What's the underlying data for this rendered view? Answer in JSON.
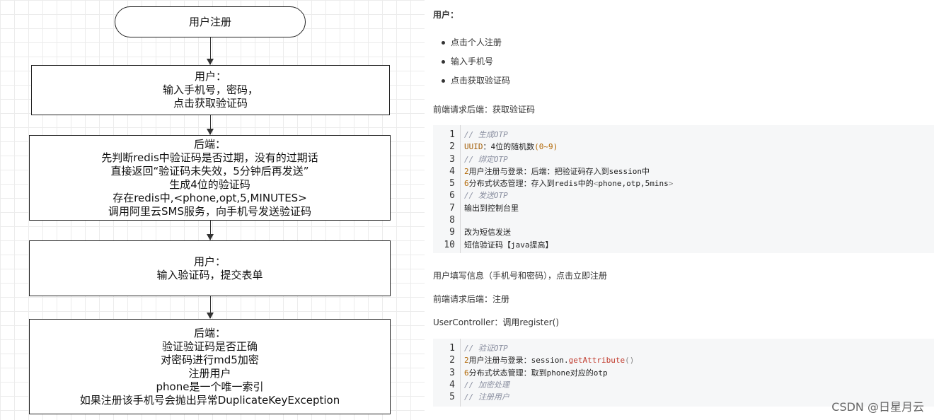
{
  "flowchart": {
    "start": "用户注册",
    "step1": [
      "用户：",
      "输入手机号，密码，",
      "点击获取验证码"
    ],
    "step2": [
      "后端：",
      "先判断redis中验证码是否过期，没有的过期话",
      "直接返回“验证码未失效，5分钟后再发送”",
      "生成4位的验证码",
      "存在redis中,<phone,opt,5,MINUTES>",
      "调用阿里云SMS服务，向手机号发送验证码"
    ],
    "step3": [
      "用户：",
      "输入验证码，提交表单"
    ],
    "step4": [
      "后端：",
      "验证验证码是否正确",
      "对密码进行md5加密",
      "注册用户",
      "phone是一个唯一索引",
      "如果注册该手机号会抛出异常DuplicateKeyException"
    ]
  },
  "doc": {
    "heading": "用户：",
    "bullets": [
      "点击个人注册",
      "输入手机号",
      "点击获取验证码"
    ],
    "p1": "前端请求后端：获取验证码",
    "code1": [
      {
        "n": "1",
        "segs": [
          {
            "t": "// 生成OTP",
            "c": "cm"
          }
        ]
      },
      {
        "n": "2",
        "segs": [
          {
            "t": "UUID",
            "c": "kw"
          },
          {
            "t": "：4位的随机数",
            "c": ""
          },
          {
            "t": "(0~9)",
            "c": "num"
          }
        ]
      },
      {
        "n": "3",
        "segs": [
          {
            "t": "// 绑定OTP",
            "c": "cm"
          }
        ]
      },
      {
        "n": "4",
        "segs": [
          {
            "t": "2",
            "c": "num"
          },
          {
            "t": "用户注册与登录：后端：把验证码存入到session中",
            "c": ""
          }
        ]
      },
      {
        "n": "5",
        "segs": [
          {
            "t": "6",
            "c": "num"
          },
          {
            "t": "分布式状态管理：存入到redis中的",
            "c": ""
          },
          {
            "t": "<",
            "c": "op"
          },
          {
            "t": "phone,otp,5mins",
            "c": ""
          },
          {
            "t": ">",
            "c": "op"
          }
        ]
      },
      {
        "n": "6",
        "segs": [
          {
            "t": "// 发送OTP",
            "c": "cm"
          }
        ]
      },
      {
        "n": "7",
        "segs": [
          {
            "t": "输出到控制台里",
            "c": ""
          }
        ]
      },
      {
        "n": "8",
        "segs": []
      },
      {
        "n": "9",
        "segs": [
          {
            "t": "改为短信发送",
            "c": ""
          }
        ]
      },
      {
        "n": "10",
        "segs": [
          {
            "t": "短信验证码【java提高】",
            "c": ""
          }
        ]
      }
    ],
    "p2": "用户填写信息（手机号和密码），点击立即注册",
    "p3": "前端请求后端：注册",
    "p4": "UserController：调用register()",
    "code2": [
      {
        "n": "1",
        "segs": [
          {
            "t": "// 验证OTP",
            "c": "cm"
          }
        ]
      },
      {
        "n": "2",
        "segs": [
          {
            "t": "2",
            "c": "num"
          },
          {
            "t": "用户注册与登录：session.",
            "c": ""
          },
          {
            "t": "getAttribute",
            "c": "fn"
          },
          {
            "t": "()",
            "c": "op"
          }
        ]
      },
      {
        "n": "3",
        "segs": [
          {
            "t": "6",
            "c": "num"
          },
          {
            "t": "分布式状态管理：取到phone对应的otp",
            "c": ""
          }
        ]
      },
      {
        "n": "4",
        "segs": [
          {
            "t": "// 加密处理",
            "c": "cm"
          }
        ]
      },
      {
        "n": "5",
        "segs": [
          {
            "t": "// 注册用户",
            "c": "cm"
          }
        ]
      }
    ]
  },
  "watermark": "CSDN @日星月云"
}
